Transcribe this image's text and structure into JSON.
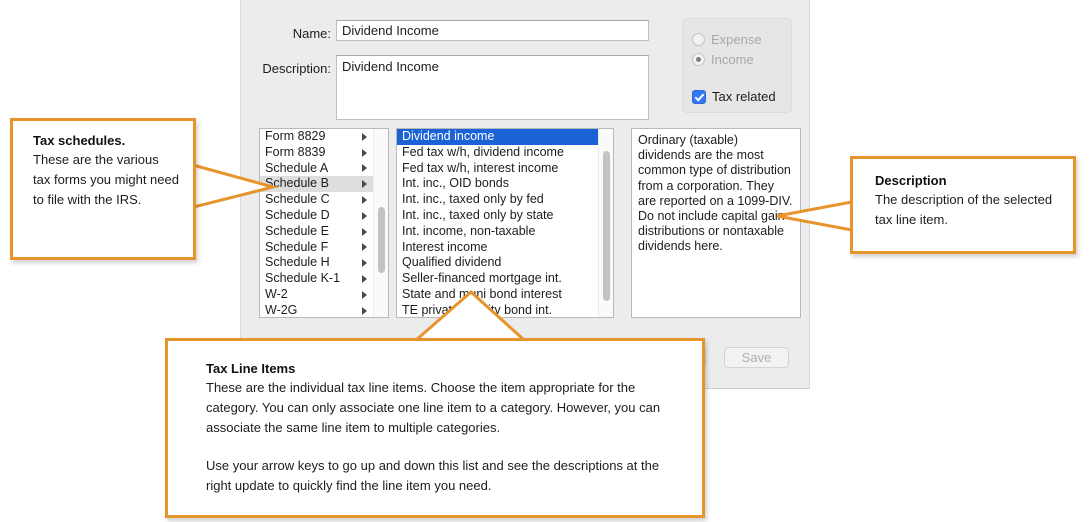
{
  "dialog": {
    "form": {
      "name_label": "Name:",
      "name_value": "Dividend Income",
      "description_label": "Description:",
      "description_value": "Dividend Income"
    },
    "type_group": {
      "expense_label": "Expense",
      "income_label": "Income",
      "tax_related_label": "Tax related",
      "expense_selected": false,
      "income_selected": true,
      "tax_related_checked": true,
      "disabled": true
    },
    "schedules_list": {
      "items": [
        "Form 8829",
        "Form 8839",
        "Schedule A",
        "Schedule B",
        "Schedule C",
        "Schedule D",
        "Schedule E",
        "Schedule F",
        "Schedule H",
        "Schedule K-1",
        "W-2",
        "W-2G"
      ],
      "selected_index": 3
    },
    "line_items_list": {
      "items": [
        "Dividend income",
        "Fed tax w/h, dividend income",
        "Fed tax w/h, interest income",
        "Int. inc., OID bonds",
        "Int. inc., taxed only by fed",
        "Int. inc., taxed only by state",
        "Int. income, non-taxable",
        "Interest income",
        "Qualified dividend",
        "Seller-financed mortgage int.",
        "State and muni bond interest",
        "TE private activity bond int."
      ],
      "selected_index": 0
    },
    "description_panel": {
      "text": "Ordinary (taxable) dividends are the most common type of distribution from a corporation.  They are reported on a 1099-DIV.  Do not include capital gain distributions or nontaxable dividends here."
    },
    "buttons": {
      "cancel_label": "",
      "save_label": "Save"
    }
  },
  "callouts": {
    "schedules": {
      "title": "Tax schedules.",
      "body": "These are the various tax forms you might need to file with the IRS."
    },
    "description": {
      "title": "Description",
      "body": "The description of the selected tax line item."
    },
    "line_items": {
      "title": "Tax Line Items",
      "paragraph1": "These are the individual tax line items. Choose the item appropriate for the category. You can only associate one line item to a category. However, you can associate the same line item to multiple categories.",
      "paragraph2": "Use your arrow keys to go up and down this list and see the  descriptions at the right update to quickly find the line item you need."
    }
  },
  "colors": {
    "callout_border": "#E8942C",
    "selection_blue": "#1A62D6",
    "checkbox_blue": "#3478F6",
    "selection_grey": "#DEDEDE"
  }
}
